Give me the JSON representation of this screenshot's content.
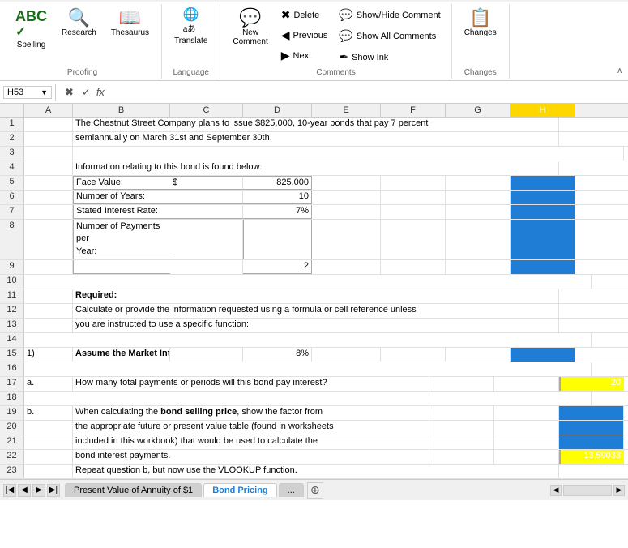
{
  "ribbon": {
    "groups": [
      {
        "name": "Proofing",
        "label": "Proofing",
        "items": [
          {
            "id": "spelling",
            "icon": "ABC✓",
            "label": "Spelling"
          },
          {
            "id": "research",
            "icon": "🔍",
            "label": "Research"
          },
          {
            "id": "thesaurus",
            "icon": "📖",
            "label": "Thesaurus"
          }
        ]
      },
      {
        "name": "Language",
        "label": "Language",
        "items": [
          {
            "id": "translate",
            "icon": "🔤",
            "label": "Translate"
          }
        ]
      },
      {
        "name": "Comments",
        "label": "Comments",
        "items": [
          {
            "id": "new-comment",
            "icon": "💬",
            "label": "New\nComment"
          },
          {
            "id": "delete",
            "icon": "✖",
            "label": "Delete"
          },
          {
            "id": "previous",
            "icon": "◀",
            "label": "Previous"
          },
          {
            "id": "next",
            "icon": "▶",
            "label": "Next"
          }
        ],
        "side_items": [
          {
            "id": "show-hide",
            "icon": "💬",
            "label": "Show/Hide Comment"
          },
          {
            "id": "show-all",
            "icon": "💬",
            "label": "Show All Comments"
          },
          {
            "id": "show-ink",
            "icon": "✒",
            "label": "Show Ink"
          }
        ]
      },
      {
        "name": "Changes",
        "label": "Changes",
        "items": [
          {
            "id": "changes",
            "icon": "📋",
            "label": "Changes"
          }
        ]
      }
    ]
  },
  "formula_bar": {
    "cell_ref": "H53",
    "fx_label": "fx"
  },
  "columns": {
    "headers": [
      "A",
      "B",
      "C",
      "D",
      "E",
      "F",
      "G",
      "H"
    ]
  },
  "rows": [
    {
      "num": "1",
      "cells": {
        "a_b_span": "The Chestnut Street Company plans to issue $825,000, 10-year bonds that pay 7 percent"
      }
    },
    {
      "num": "2",
      "cells": {
        "a_b_span": "semiannually on March 31st and September 30th."
      }
    },
    {
      "num": "3",
      "cells": {}
    },
    {
      "num": "4",
      "cells": {
        "a_b_span": "Information relating to this bond is found below:"
      }
    },
    {
      "num": "5",
      "cells": {
        "b": "Face Value:",
        "c": "$",
        "d": "825,000"
      }
    },
    {
      "num": "6",
      "cells": {
        "b": "Number of Years:",
        "d": "10"
      }
    },
    {
      "num": "7",
      "cells": {
        "b": "Stated Interest Rate:",
        "d": "7%"
      }
    },
    {
      "num": "8",
      "cells": {
        "b_span": "Number of Payments per\nYear:"
      }
    },
    {
      "num": "9",
      "cells": {
        "d": "2"
      }
    },
    {
      "num": "10",
      "cells": {}
    },
    {
      "num": "11",
      "cells": {
        "a": "Required:"
      }
    },
    {
      "num": "12",
      "cells": {
        "a_span": "Calculate or provide the information requested using a formula or cell reference unless"
      }
    },
    {
      "num": "13",
      "cells": {
        "a_span": "you are instructed to use a specific function:"
      }
    },
    {
      "num": "14",
      "cells": {}
    },
    {
      "num": "15",
      "cells": {
        "a": "1)",
        "b_span": "Assume the Market Interest Rate is:",
        "d": "8%"
      }
    },
    {
      "num": "16",
      "cells": {}
    },
    {
      "num": "17",
      "cells": {
        "a": "a.",
        "b_span": "How many total payments or periods will this bond pay interest?",
        "h": "20",
        "h_yellow": true
      }
    },
    {
      "num": "18",
      "cells": {}
    },
    {
      "num": "19",
      "cells": {
        "a": "b.",
        "b_span": "When calculating the bond selling price, show the factor from"
      }
    },
    {
      "num": "20",
      "cells": {
        "b_span": "the appropriate future or present value table (found in worksheets"
      }
    },
    {
      "num": "21",
      "cells": {
        "b_span": "included in this workbook) that would be used to calculate the"
      }
    },
    {
      "num": "22",
      "cells": {
        "b_span": "bond interest payments.",
        "h": "13.59033",
        "h_yellow": true
      }
    },
    {
      "num": "23",
      "cells": {
        "a_span": "Repeat question b, but now use the VLOOKUP function."
      }
    }
  ],
  "sheet_tabs": [
    {
      "id": "annuity",
      "label": "Present Value of Annuity of $1",
      "active": false
    },
    {
      "id": "bond-pricing",
      "label": "Bond Pricing",
      "active": true
    },
    {
      "id": "more",
      "label": "...",
      "active": false
    }
  ],
  "row_numbers": [
    "1",
    "2",
    "3",
    "4",
    "5",
    "6",
    "7",
    "8",
    "9",
    "10",
    "11",
    "12",
    "13",
    "14",
    "15",
    "16",
    "17",
    "18",
    "19",
    "20",
    "21",
    "22",
    "23"
  ]
}
